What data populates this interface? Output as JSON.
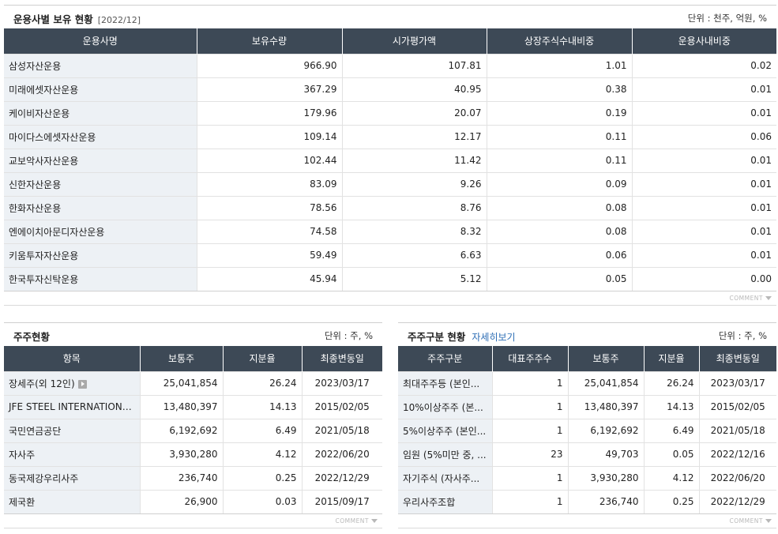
{
  "holdings": {
    "title": "운용사별 보유 현황",
    "date": "[2022/12]",
    "unit": "단위 : 천주, 억원, %",
    "headers": [
      "운용사명",
      "보유수량",
      "시가평가액",
      "상장주식수내비중",
      "운용사내비중"
    ],
    "rows": [
      [
        "삼성자산운용",
        "966.90",
        "107.81",
        "1.01",
        "0.02"
      ],
      [
        "미래에셋자산운용",
        "367.29",
        "40.95",
        "0.38",
        "0.01"
      ],
      [
        "케이비자산운용",
        "179.96",
        "20.07",
        "0.19",
        "0.01"
      ],
      [
        "마이다스에셋자산운용",
        "109.14",
        "12.17",
        "0.11",
        "0.06"
      ],
      [
        "교보악사자산운용",
        "102.44",
        "11.42",
        "0.11",
        "0.01"
      ],
      [
        "신한자산운용",
        "83.09",
        "9.26",
        "0.09",
        "0.01"
      ],
      [
        "한화자산운용",
        "78.56",
        "8.76",
        "0.08",
        "0.01"
      ],
      [
        "엔에이치아문디자산운용",
        "74.58",
        "8.32",
        "0.08",
        "0.01"
      ],
      [
        "키움투자자산운용",
        "59.49",
        "6.63",
        "0.06",
        "0.01"
      ],
      [
        "한국투자신탁운용",
        "45.94",
        "5.12",
        "0.05",
        "0.00"
      ]
    ],
    "comment": "COMMENT"
  },
  "shareholders": {
    "title": "주주현황",
    "unit": "단위 : 주, %",
    "headers": [
      "항목",
      "보통주",
      "지분율",
      "최종변동일"
    ],
    "rows": [
      [
        "장세주(외 12인)",
        "25,041,854",
        "26.24",
        "2023/03/17"
      ],
      [
        "JFE STEEL INTERNATIONAL...",
        "13,480,397",
        "14.13",
        "2015/02/05"
      ],
      [
        "국민연금공단",
        "6,192,692",
        "6.49",
        "2021/05/18"
      ],
      [
        "자사주",
        "3,930,280",
        "4.12",
        "2022/06/20"
      ],
      [
        "동국제강우리사주",
        "236,740",
        "0.25",
        "2022/12/29"
      ],
      [
        "제국환",
        "26,900",
        "0.03",
        "2015/09/17"
      ]
    ],
    "comment": "COMMENT"
  },
  "classification": {
    "title": "주주구분 현황",
    "link": "자세히보기",
    "unit": "단위 : 주, %",
    "headers": [
      "주주구분",
      "대표주주수",
      "보통주",
      "지분율",
      "최종변동일"
    ],
    "rows": [
      [
        "최대주주등 (본인...",
        "1",
        "25,041,854",
        "26.24",
        "2023/03/17"
      ],
      [
        "10%이상주주 (본...",
        "1",
        "13,480,397",
        "14.13",
        "2015/02/05"
      ],
      [
        "5%이상주주 (본인...",
        "1",
        "6,192,692",
        "6.49",
        "2021/05/18"
      ],
      [
        "임원 (5%미만 중, ...",
        "23",
        "49,703",
        "0.05",
        "2022/12/16"
      ],
      [
        "자기주식 (자사주...",
        "1",
        "3,930,280",
        "4.12",
        "2022/06/20"
      ],
      [
        "우리사주조합",
        "1",
        "236,740",
        "0.25",
        "2022/12/29"
      ]
    ],
    "comment": "COMMENT"
  }
}
